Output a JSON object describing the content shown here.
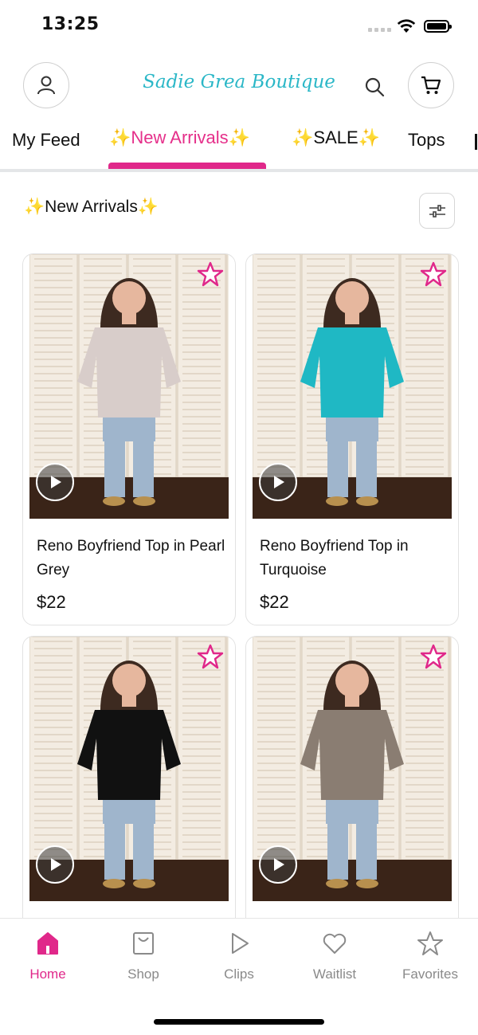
{
  "status_bar": {
    "time": "13:25"
  },
  "header": {
    "brand": "Sadie Grea Boutique"
  },
  "tabs": [
    {
      "label": "My Feed"
    },
    {
      "label": "✨New Arrivals✨"
    },
    {
      "label": "✨SALE✨"
    },
    {
      "label": "Tops"
    }
  ],
  "section": {
    "title": "✨New Arrivals✨"
  },
  "products": [
    {
      "name": "Reno Boyfriend Top in Pearl Grey",
      "price": "$22",
      "shirt_color": "#d8cdca"
    },
    {
      "name": "Reno Boyfriend Top in Turquoise",
      "price": "$22",
      "shirt_color": "#1fb8c4"
    },
    {
      "name": "",
      "price": "",
      "shirt_color": "#111111"
    },
    {
      "name": "",
      "price": "",
      "shirt_color": "#8a7d72"
    }
  ],
  "bottom_nav": [
    {
      "label": "Home",
      "icon": "home-icon"
    },
    {
      "label": "Shop",
      "icon": "shop-bag-icon"
    },
    {
      "label": "Clips",
      "icon": "play-icon"
    },
    {
      "label": "Waitlist",
      "icon": "heart-icon"
    },
    {
      "label": "Favorites",
      "icon": "star-icon"
    }
  ],
  "colors": {
    "accent": "#e0288a",
    "brand": "#2bb7c7",
    "inactive": "#8a8a8a"
  }
}
